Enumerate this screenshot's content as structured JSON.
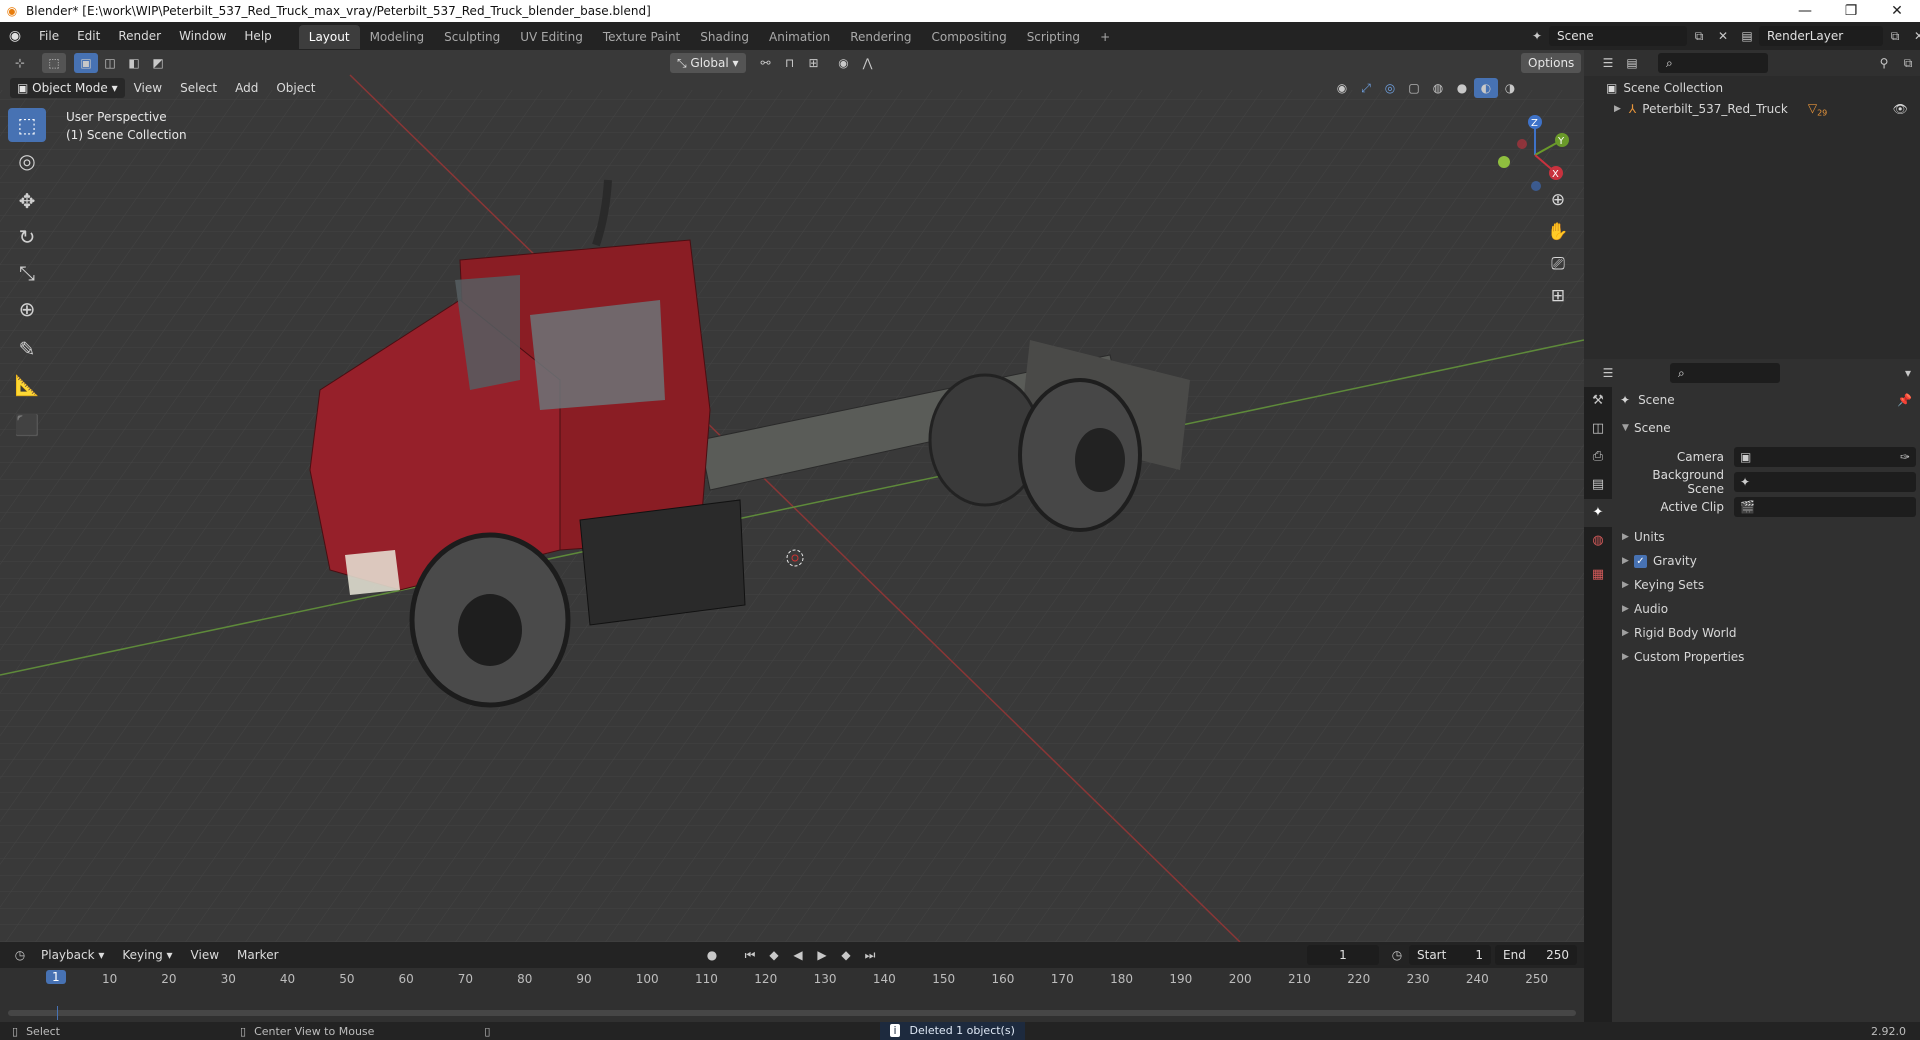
{
  "window": {
    "title": "Blender* [E:\\work\\WIP\\Peterbilt_537_Red_Truck_max_vray/Peterbilt_537_Red_Truck_blender_base.blend]",
    "minimize": "—",
    "restore": "❐",
    "close": "✕"
  },
  "menu": [
    "File",
    "Edit",
    "Render",
    "Window",
    "Help"
  ],
  "workspaces": [
    {
      "label": "Layout",
      "active": true
    },
    {
      "label": "Modeling"
    },
    {
      "label": "Sculpting"
    },
    {
      "label": "UV Editing"
    },
    {
      "label": "Texture Paint"
    },
    {
      "label": "Shading"
    },
    {
      "label": "Animation"
    },
    {
      "label": "Rendering"
    },
    {
      "label": "Compositing"
    },
    {
      "label": "Scripting"
    }
  ],
  "add_workspace": "+",
  "scene_selector": "Scene",
  "renderlayer_selector": "RenderLayer",
  "viewport": {
    "transform_orientation": "Global",
    "options": "Options",
    "mode": "Object Mode",
    "menus": [
      "View",
      "Select",
      "Add",
      "Object"
    ],
    "overlay_line1": "User Perspective",
    "overlay_line2": "(1) Scene Collection",
    "gizmo": {
      "z": "Z",
      "y": "Y",
      "x": "X"
    }
  },
  "outliner": {
    "root": "Scene Collection",
    "items": [
      {
        "label": "Peterbilt_537_Red_Truck",
        "badge": "29"
      }
    ]
  },
  "properties": {
    "header": "Scene",
    "section": "Scene",
    "fields": [
      {
        "label": "Camera"
      },
      {
        "label": "Background Scene"
      },
      {
        "label": "Active Clip"
      }
    ],
    "panels": [
      {
        "label": "Units",
        "checkbox": false
      },
      {
        "label": "Gravity",
        "checkbox": true
      },
      {
        "label": "Keying Sets",
        "checkbox": false
      },
      {
        "label": "Audio",
        "checkbox": false
      },
      {
        "label": "Rigid Body World",
        "checkbox": false
      },
      {
        "label": "Custom Properties",
        "checkbox": false
      }
    ]
  },
  "timeline": {
    "menus": [
      "Playback",
      "Keying",
      "View",
      "Marker"
    ],
    "current_frame": "1",
    "start_label": "Start",
    "start": "1",
    "end_label": "End",
    "end": "250",
    "ticks": [
      "10",
      "20",
      "30",
      "40",
      "50",
      "60",
      "70",
      "80",
      "90",
      "100",
      "110",
      "120",
      "130",
      "140",
      "150",
      "160",
      "170",
      "180",
      "190",
      "200",
      "210",
      "220",
      "230",
      "240",
      "250"
    ],
    "playhead": "1"
  },
  "status": {
    "select": "Select",
    "center_view": "Center View to Mouse",
    "message": "Deleted 1 object(s)",
    "version": "2.92.0"
  }
}
